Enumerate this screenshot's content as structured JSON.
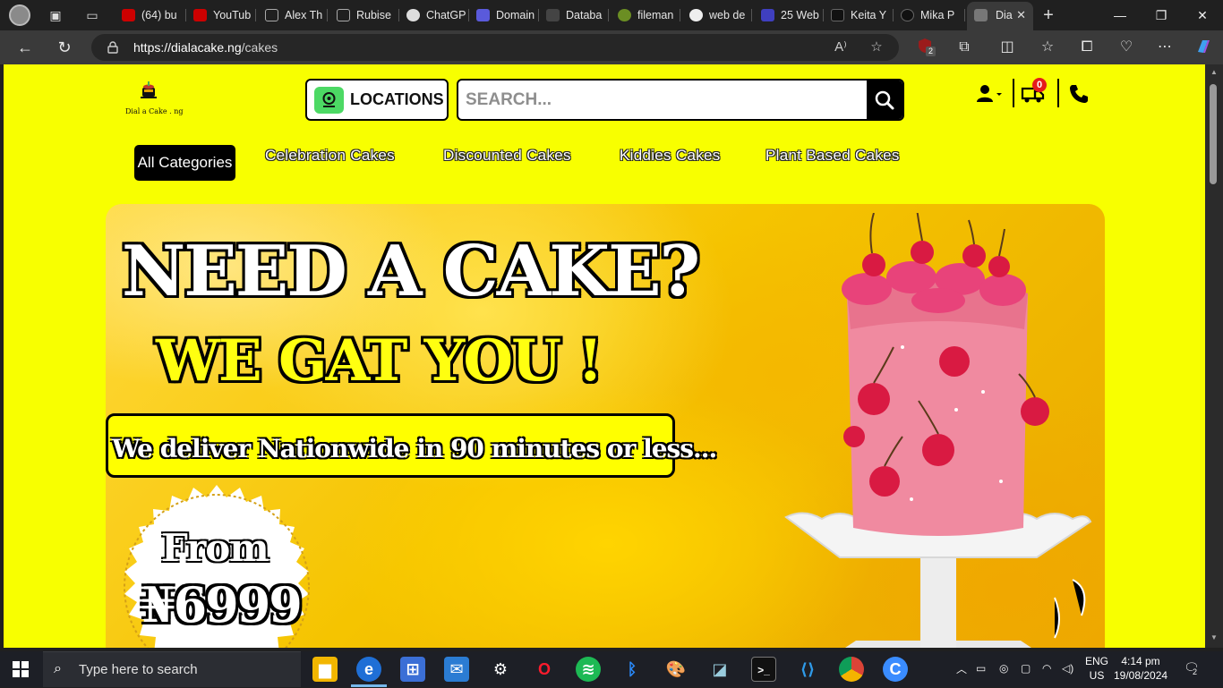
{
  "browser": {
    "tabs": [
      {
        "label": "(64) bu",
        "fav_color": "#c00"
      },
      {
        "label": "YouTub",
        "fav_color": "#c00"
      },
      {
        "label": "Alex Th",
        "fav_color": "#555"
      },
      {
        "label": "Rubise",
        "fav_color": "#555"
      },
      {
        "label": "ChatGP",
        "fav_color": "#ddd"
      },
      {
        "label": "Domain",
        "fav_color": "#5a5adb"
      },
      {
        "label": "Databa",
        "fav_color": "#333"
      },
      {
        "label": "fileman",
        "fav_color": "#6b8e23"
      },
      {
        "label": "web de",
        "fav_color": "#eee"
      },
      {
        "label": "25 Web",
        "fav_color": "#3f3fbf"
      },
      {
        "label": "Keita Y",
        "fav_color": "#111"
      },
      {
        "label": "Mika P",
        "fav_color": "#111"
      },
      {
        "label": "Dia",
        "fav_color": "#888",
        "active": true
      }
    ],
    "url_host": "https://dialacake.ng",
    "url_path": "/cakes",
    "ext_badge": "2",
    "window_controls": {
      "minimize": "—",
      "maximize": "❐",
      "close": "✕"
    }
  },
  "site": {
    "logo_text": "Dial a Cake . ng",
    "locations_label": "LOCATIONS",
    "search_placeholder": "SEARCH...",
    "cart_count": "0",
    "categories": {
      "all": "All Categories",
      "items": [
        "Celebration Cakes",
        "Discounted Cakes",
        "Kiddies Cakes",
        "Plant Based Cakes"
      ]
    },
    "hero": {
      "headline": "NEED A CAKE?",
      "subheadline": "WE GAT YOU !",
      "delivery_text": "We deliver Nationwide in 90 minutes or less...",
      "price_prefix": "From",
      "price": "₦6999"
    }
  },
  "taskbar": {
    "search_placeholder": "Type here to search",
    "lang_top": "ENG",
    "lang_bottom": "US",
    "time": "4:14 pm",
    "date": "19/08/2024",
    "notification_count": "2"
  },
  "colors": {
    "page_bg": "#f8ff00",
    "locations_pin": "#4cd964",
    "cart_badge": "#e41b1b"
  }
}
